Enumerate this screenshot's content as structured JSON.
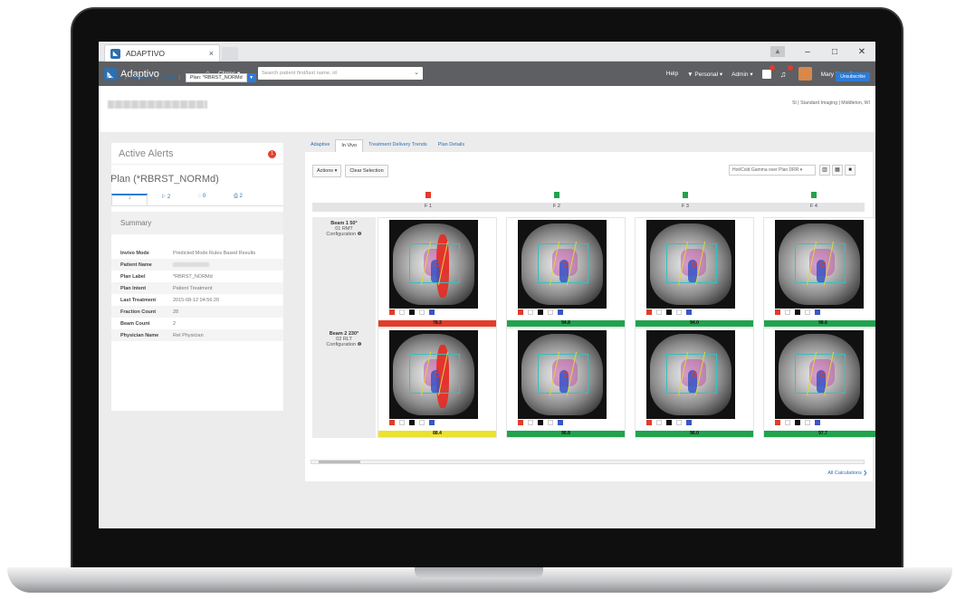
{
  "browser": {
    "tab_title": "ADAPTIVO",
    "tab_close": "×",
    "controls": [
      "–",
      "□",
      "✕"
    ]
  },
  "nav": {
    "brand": "Adaptivo",
    "clinics": "Clinics ▾",
    "search_placeholder": "Search patient first/last name, id",
    "help": "Help",
    "personal": "▼ Personal ▾",
    "admin": "Admin ▾",
    "notif_count_1": "2",
    "notif_count_2": "1",
    "user": "Mary Napolitano ▾"
  },
  "header": {
    "org": "SI | Standard Imaging | Middleton, WI",
    "breadcrumbs": [
      "Clinics",
      "Patient List",
      "Patient"
    ],
    "plan_select": "Plan: *RBRST_NORMd",
    "unsubscribe": "Unsubscribe"
  },
  "left": {
    "alerts_title": "Active Alerts",
    "alerts_count": "1",
    "plan_title": "Plan (*RBRST_NORMd)",
    "tabs": [
      "↓",
      "⚐ 2",
      "◌ 0",
      "⎙ 2"
    ],
    "summary_title": "Summary",
    "fields": [
      {
        "k": "Invivo Mode",
        "v": "Predicted Mode Rules Based Results"
      },
      {
        "k": "Patient Name",
        "v": ""
      },
      {
        "k": "Plan Label",
        "v": "*RBRST_NORMd"
      },
      {
        "k": "Plan Intent",
        "v": "Patient Treatment"
      },
      {
        "k": "Last Treatment",
        "v": "2015-08-12 04:56:20"
      },
      {
        "k": "Fraction Count",
        "v": "28"
      },
      {
        "k": "Beam Count",
        "v": "2"
      },
      {
        "k": "Physician Name",
        "v": "Ret Physician"
      }
    ]
  },
  "right": {
    "tabs": [
      "Adaptive",
      "In Vivo",
      "Treatment Delivery Trends",
      "Plan Details"
    ],
    "active_tab": 1,
    "actions": "Actions ▾",
    "clear": "Clear Selection",
    "view_select": "Hot/Cold Gamma over Plan DRR  ▾",
    "view_icons": [
      "▥",
      "▦",
      "■"
    ],
    "fractions": [
      "F 1",
      "F 2",
      "F 3",
      "F 4"
    ],
    "fraction_status": [
      "red",
      "green",
      "green",
      "green"
    ],
    "beams": [
      {
        "name": "Beam 1 50°",
        "id": "01 RMT",
        "config": "Configuration ❶",
        "scores": [
          "78.2",
          "94.8",
          "94.0",
          "98.6"
        ],
        "status": [
          "r",
          "g",
          "g",
          "g"
        ]
      },
      {
        "name": "Beam 2 230°",
        "id": "02 RLT",
        "config": "Configuration ❶",
        "scores": [
          "88.4",
          "96.8",
          "96.0",
          "97.7"
        ],
        "status": [
          "y",
          "g",
          "g",
          "g"
        ]
      }
    ],
    "all_calcs": "All Calculations ❯"
  },
  "colors": {
    "accent": "#2d7bd6",
    "pass": "#21a34e",
    "fail": "#e23c2b",
    "warn": "#ebe22e",
    "nav": "#5d5f62"
  }
}
